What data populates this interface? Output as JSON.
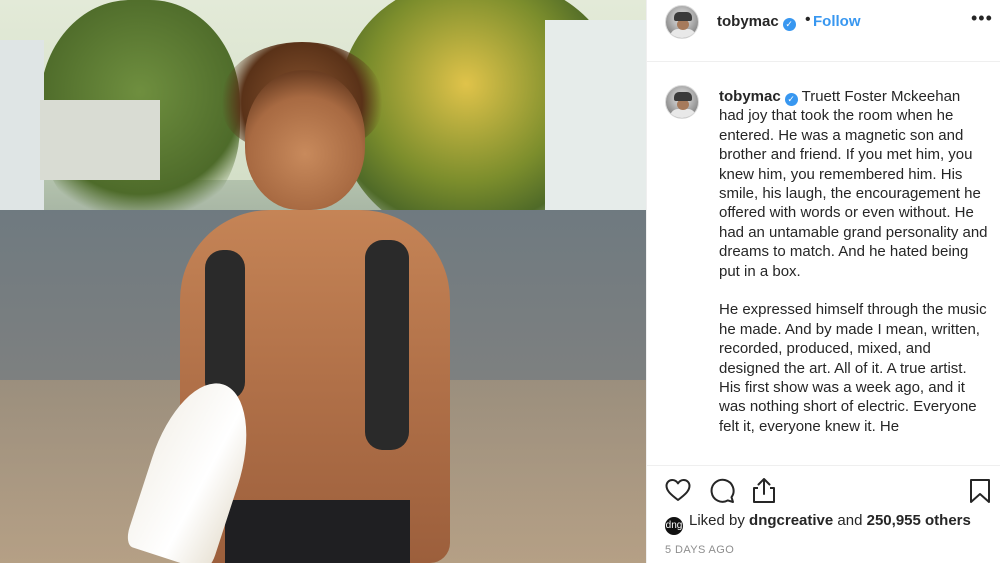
{
  "post": {
    "photo_alt": "",
    "header": {
      "username": "tobymac",
      "verified_glyph": "✓",
      "separator": "•",
      "follow_label": "Follow",
      "more_label": "•••"
    },
    "caption": {
      "username": "tobymac",
      "verified_glyph": "✓",
      "paragraphs": [
        "Truett Foster Mckeehan had joy that took the room when he entered. He was a magnetic son and brother and friend. If you met him, you knew him, you remembered him. His smile, his laugh, the encouragement he offered with words or even without. He had an untamable grand personality and dreams to match. And he hated being put in a box.",
        "He expressed himself through the music he made. And by made I mean, written, recorded, produced, mixed, and designed the art. All of it. A true artist. His first show was a week ago, and it was nothing short of electric. Everyone felt it, everyone knew it. He"
      ]
    },
    "actions": {
      "icons": [
        "heart-icon",
        "comment-icon",
        "share-icon",
        "bookmark-icon"
      ]
    },
    "likes": {
      "avatar_glyph": "dng",
      "prefix": "Liked by",
      "liker": "dngcreative",
      "conjunction": "and",
      "others": "250,955 others"
    },
    "timestamp": "5 DAYS AGO",
    "colors": {
      "link_blue": "#3897f0",
      "text": "#262626",
      "muted": "#8e8e8e",
      "divider": "#efefef"
    }
  }
}
